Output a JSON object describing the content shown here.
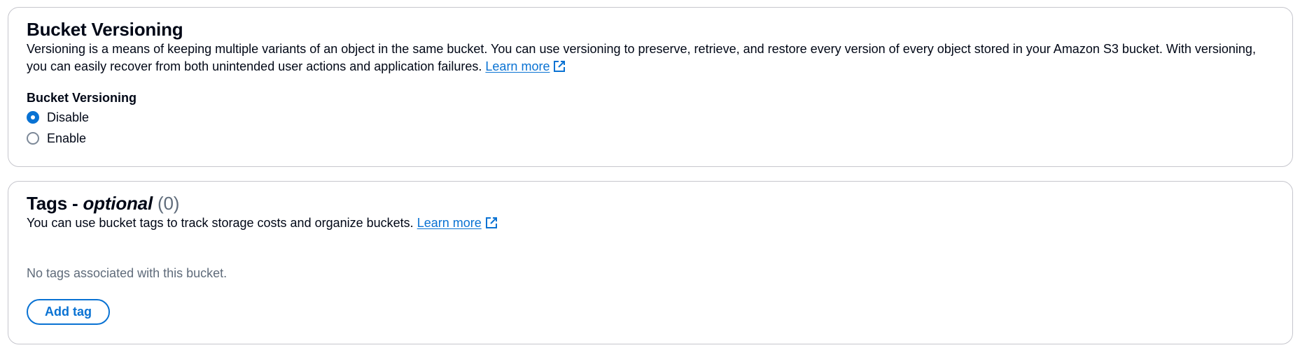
{
  "versioning": {
    "title": "Bucket Versioning",
    "description": "Versioning is a means of keeping multiple variants of an object in the same bucket. You can use versioning to preserve, retrieve, and restore every version of every object stored in your Amazon S3 bucket. With versioning, you can easily recover from both unintended user actions and application failures.",
    "learn_more": "Learn more",
    "field_label": "Bucket Versioning",
    "options": [
      {
        "label": "Disable",
        "selected": true
      },
      {
        "label": "Enable",
        "selected": false
      }
    ]
  },
  "tags": {
    "title": "Tags - ",
    "title_optional": "optional",
    "count": "(0)",
    "description": "You can use bucket tags to track storage costs and organize buckets.",
    "learn_more": "Learn more",
    "empty_text": "No tags associated with this bucket.",
    "add_button": "Add tag"
  },
  "icons": {
    "external_link": "external-link-icon"
  },
  "colors": {
    "link": "#0972d3",
    "text": "#000716",
    "secondary_text": "#5f6b7a",
    "border": "#c6c6cd"
  }
}
